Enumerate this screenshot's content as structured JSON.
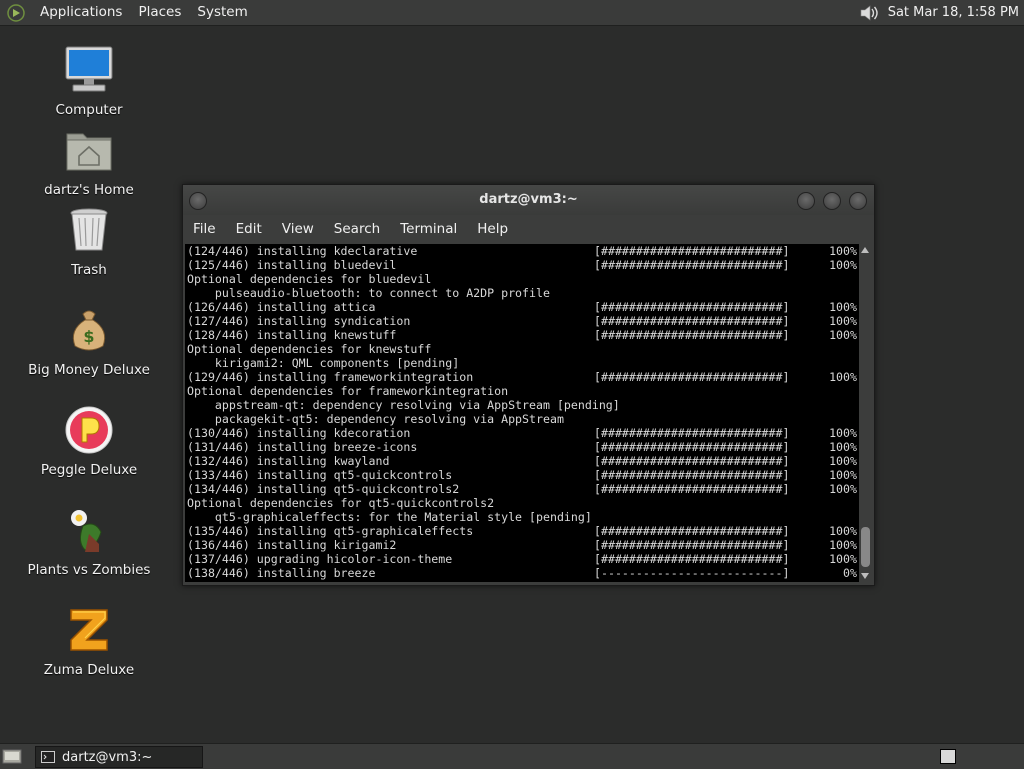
{
  "top_panel": {
    "menus": [
      "Applications",
      "Places",
      "System"
    ],
    "clock": "Sat Mar 18,  1:58 PM"
  },
  "desktop_icons": [
    {
      "label": "Computer",
      "icon": "computer-icon"
    },
    {
      "label": "dartz's Home",
      "icon": "home-folder-icon"
    },
    {
      "label": "Trash",
      "icon": "trash-icon"
    },
    {
      "label": "Big Money Deluxe",
      "icon": "money-bag-icon"
    },
    {
      "label": "Peggle Deluxe",
      "icon": "peggle-icon"
    },
    {
      "label": "Plants vs Zombies",
      "icon": "plants-vs-zombies-icon"
    },
    {
      "label": "Zuma Deluxe",
      "icon": "zuma-icon"
    }
  ],
  "terminal": {
    "title": "dartz@vm3:~",
    "menus": [
      "File",
      "Edit",
      "View",
      "Search",
      "Terminal",
      "Help"
    ],
    "lines": [
      {
        "text": "(124/446) installing kdeclarative",
        "bar": "[##########################]",
        "pct": "100%"
      },
      {
        "text": "(125/446) installing bluedevil",
        "bar": "[##########################]",
        "pct": "100%"
      },
      {
        "text": "Optional dependencies for bluedevil",
        "bar": "",
        "pct": ""
      },
      {
        "text": "    pulseaudio-bluetooth: to connect to A2DP profile",
        "bar": "",
        "pct": ""
      },
      {
        "text": "(126/446) installing attica",
        "bar": "[##########################]",
        "pct": "100%"
      },
      {
        "text": "(127/446) installing syndication",
        "bar": "[##########################]",
        "pct": "100%"
      },
      {
        "text": "(128/446) installing knewstuff",
        "bar": "[##########################]",
        "pct": "100%"
      },
      {
        "text": "Optional dependencies for knewstuff",
        "bar": "",
        "pct": ""
      },
      {
        "text": "    kirigami2: QML components [pending]",
        "bar": "",
        "pct": ""
      },
      {
        "text": "(129/446) installing frameworkintegration",
        "bar": "[##########################]",
        "pct": "100%"
      },
      {
        "text": "Optional dependencies for frameworkintegration",
        "bar": "",
        "pct": ""
      },
      {
        "text": "    appstream-qt: dependency resolving via AppStream [pending]",
        "bar": "",
        "pct": ""
      },
      {
        "text": "    packagekit-qt5: dependency resolving via AppStream",
        "bar": "",
        "pct": ""
      },
      {
        "text": "(130/446) installing kdecoration",
        "bar": "[##########################]",
        "pct": "100%"
      },
      {
        "text": "(131/446) installing breeze-icons",
        "bar": "[##########################]",
        "pct": "100%"
      },
      {
        "text": "(132/446) installing kwayland",
        "bar": "[##########################]",
        "pct": "100%"
      },
      {
        "text": "(133/446) installing qt5-quickcontrols",
        "bar": "[##########################]",
        "pct": "100%"
      },
      {
        "text": "(134/446) installing qt5-quickcontrols2",
        "bar": "[##########################]",
        "pct": "100%"
      },
      {
        "text": "Optional dependencies for qt5-quickcontrols2",
        "bar": "",
        "pct": ""
      },
      {
        "text": "    qt5-graphicaleffects: for the Material style [pending]",
        "bar": "",
        "pct": ""
      },
      {
        "text": "(135/446) installing qt5-graphicaleffects",
        "bar": "[##########################]",
        "pct": "100%"
      },
      {
        "text": "(136/446) installing kirigami2",
        "bar": "[##########################]",
        "pct": "100%"
      },
      {
        "text": "(137/446) upgrading hicolor-icon-theme",
        "bar": "[##########################]",
        "pct": "100%"
      },
      {
        "text": "(138/446) installing breeze",
        "bar": "[--------------------------]",
        "pct": "0%"
      }
    ]
  },
  "taskbar": {
    "task_label": "dartz@vm3:~"
  }
}
